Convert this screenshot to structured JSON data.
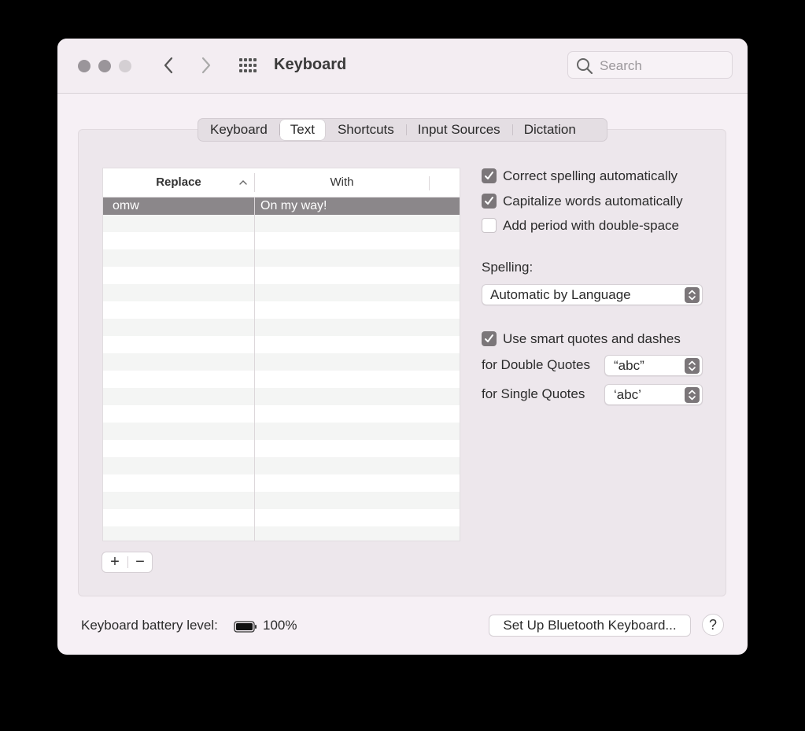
{
  "window": {
    "title": "Keyboard"
  },
  "toolbar": {
    "back_icon": "chevron-left-icon",
    "forward_icon": "chevron-right-icon",
    "show_all_icon": "grid-icon",
    "search_placeholder": "Search"
  },
  "tabs": [
    {
      "label": "Keyboard",
      "active": false
    },
    {
      "label": "Text",
      "active": true
    },
    {
      "label": "Shortcuts",
      "active": false
    },
    {
      "label": "Input Sources",
      "active": false
    },
    {
      "label": "Dictation",
      "active": false
    }
  ],
  "replacements": {
    "columns": {
      "replace": "Replace",
      "with": "With"
    },
    "rows": [
      {
        "replace": "omw",
        "with": "On my way!",
        "selected": true
      }
    ],
    "add_label": "+",
    "remove_label": "−"
  },
  "options": {
    "correct_spelling": {
      "label": "Correct spelling automatically",
      "checked": true
    },
    "capitalize_words": {
      "label": "Capitalize words automatically",
      "checked": true
    },
    "add_period": {
      "label": "Add period with double-space",
      "checked": false
    },
    "smart_quotes": {
      "label": "Use smart quotes and dashes",
      "checked": true
    }
  },
  "spelling": {
    "label": "Spelling:",
    "value": "Automatic by Language"
  },
  "quotes": {
    "double_label": "for Double Quotes",
    "double_value": "“abc”",
    "single_label": "for Single Quotes",
    "single_value": "‘abc’"
  },
  "footer": {
    "battery_label": "Keyboard battery level:",
    "battery_percent": "100%",
    "battery_level": 1.0,
    "setup_button": "Set Up Bluetooth Keyboard...",
    "help_button": "?"
  },
  "colors": {
    "window_bg": "#f6f0f5",
    "selection": "#8b878a",
    "checkbox_on": "#7b7679"
  }
}
